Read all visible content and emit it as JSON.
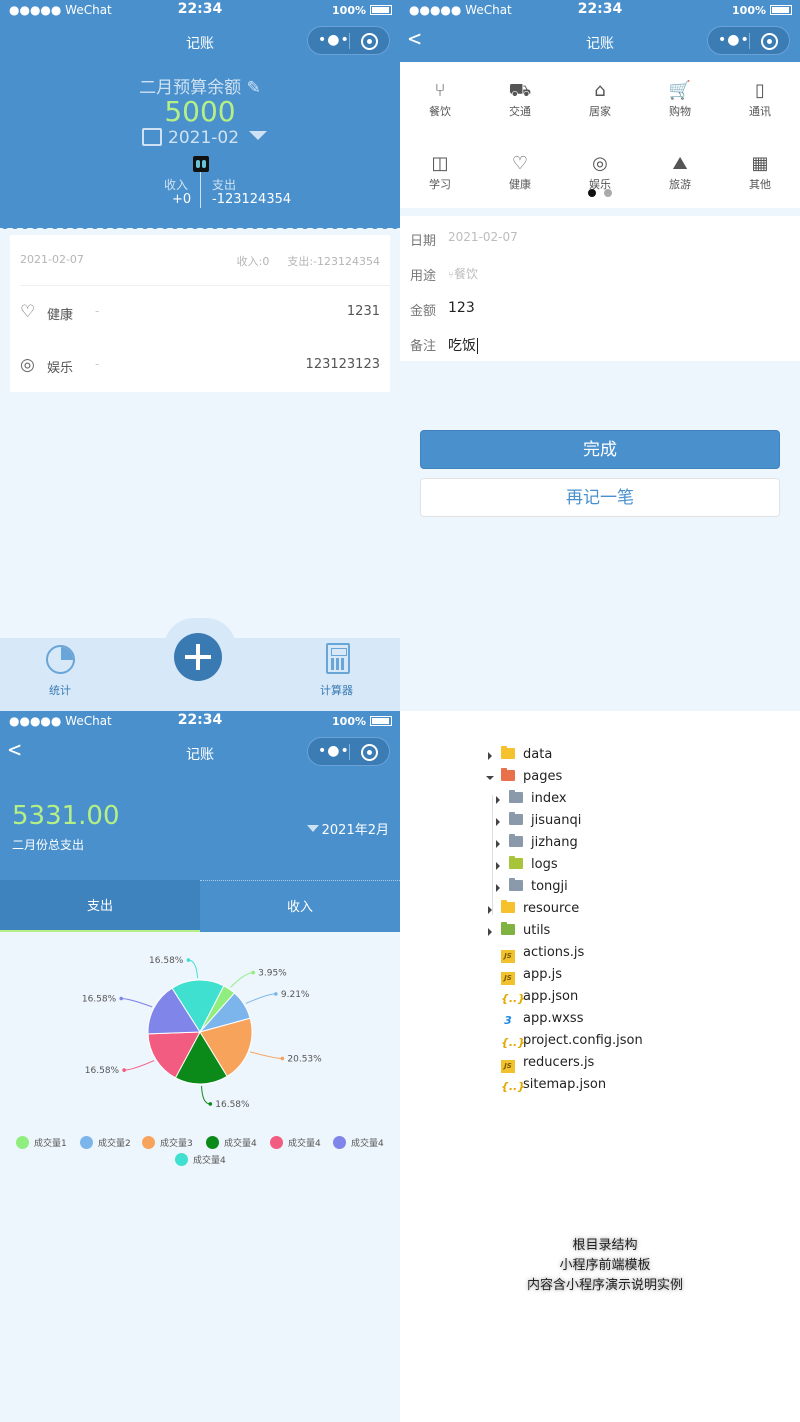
{
  "status_bar": {
    "carrier": "●●●●● WeChat",
    "time": "22:34",
    "battery": "100%"
  },
  "nav": {
    "title": "记账",
    "capsule_dots": "•●•"
  },
  "home": {
    "budget_label": "二月预算余额",
    "budget_value": "5000",
    "month": "2021-02",
    "income_label": "收入",
    "income_value": "+0",
    "expense_label": "支出",
    "expense_value": "-123124354",
    "day_card": {
      "date": "2021-02-07",
      "income": "收入:0",
      "expense": "支出:-123124354",
      "records": [
        {
          "category": "健康",
          "dash": "-",
          "amount": "1231",
          "icon": "heart-pulse-icon"
        },
        {
          "category": "娱乐",
          "dash": "-",
          "amount": "123123123",
          "icon": "entertainment-icon"
        }
      ]
    },
    "tabbar": {
      "stats_label": "统计",
      "calculator_label": "计算器"
    }
  },
  "add": {
    "categories": [
      {
        "label": "餐饮",
        "icon": "fork-knife-icon",
        "glyph": "⑂"
      },
      {
        "label": "交通",
        "icon": "bus-icon",
        "glyph": "⛟"
      },
      {
        "label": "居家",
        "icon": "house-icon",
        "glyph": "⌂"
      },
      {
        "label": "购物",
        "icon": "cart-icon",
        "glyph": "🛒"
      },
      {
        "label": "通讯",
        "icon": "phone-icon",
        "glyph": "▯"
      },
      {
        "label": "学习",
        "icon": "book-icon",
        "glyph": "◫"
      },
      {
        "label": "健康",
        "icon": "heart-pulse-icon",
        "glyph": "♡"
      },
      {
        "label": "娱乐",
        "icon": "entertainment-icon",
        "glyph": "◎"
      },
      {
        "label": "旅游",
        "icon": "mountain-icon",
        "glyph": "⛰"
      },
      {
        "label": "其他",
        "icon": "grid-icon",
        "glyph": "▦"
      }
    ],
    "page_indicator": {
      "active": 1,
      "total": 2
    },
    "form": {
      "date_label": "日期",
      "date_value": "2021-02-07",
      "use_label": "用途",
      "use_value": "餐饮",
      "amount_label": "金额",
      "amount_value": "123",
      "note_label": "备注",
      "note_value": "吃饭"
    },
    "done_button": "完成",
    "again_button": "再记一笔"
  },
  "stats": {
    "total_value": "5331.00",
    "total_label": "二月份总支出",
    "month": "2021年2月",
    "tab_expense": "支出",
    "tab_income": "收入"
  },
  "chart_data": {
    "type": "pie",
    "slices": [
      {
        "name": "成交量1",
        "value": 3.95,
        "label": "3.95%",
        "color": "#90ee7e"
      },
      {
        "name": "成交量2",
        "value": 9.21,
        "label": "9.21%",
        "color": "#7cb5ec"
      },
      {
        "name": "成交量3",
        "value": 20.53,
        "label": "20.53%",
        "color": "#f7a35c"
      },
      {
        "name": "成交量4",
        "value": 16.58,
        "label": "16.58%",
        "color": "#0b8a1a"
      },
      {
        "name": "成交量4",
        "value": 16.58,
        "label": "16.58%",
        "color": "#f15c80"
      },
      {
        "name": "成交量4",
        "value": 16.58,
        "label": "16.58%",
        "color": "#8085e9"
      },
      {
        "name": "成交量4",
        "value": 16.58,
        "label": "16.58%",
        "color": "#40e0d0"
      }
    ]
  },
  "tree": {
    "items": [
      {
        "name": "data",
        "type": "folder",
        "color": "#f5c22e",
        "level": 0,
        "arrow": "closed"
      },
      {
        "name": "pages",
        "type": "folder",
        "color": "#e8704a",
        "level": 0,
        "arrow": "open"
      },
      {
        "name": "index",
        "type": "folder",
        "color": "#8a9aab",
        "level": 1,
        "arrow": "closed"
      },
      {
        "name": "jisuanqi",
        "type": "folder",
        "color": "#8a9aab",
        "level": 1,
        "arrow": "closed"
      },
      {
        "name": "jizhang",
        "type": "folder",
        "color": "#8a9aab",
        "level": 1,
        "arrow": "closed"
      },
      {
        "name": "logs",
        "type": "folder",
        "color": "#a7c43a",
        "level": 1,
        "arrow": "closed"
      },
      {
        "name": "tongji",
        "type": "folder",
        "color": "#8a9aab",
        "level": 1,
        "arrow": "closed"
      },
      {
        "name": "resource",
        "type": "folder",
        "color": "#f5c22e",
        "level": 0,
        "arrow": "closed"
      },
      {
        "name": "utils",
        "type": "folder",
        "color": "#7fb241",
        "level": 0,
        "arrow": "closed"
      },
      {
        "name": "actions.js",
        "type": "js",
        "level": 0
      },
      {
        "name": "app.js",
        "type": "js",
        "level": 0
      },
      {
        "name": "app.json",
        "type": "json",
        "level": 0
      },
      {
        "name": "app.wxss",
        "type": "css",
        "level": 0
      },
      {
        "name": "project.config.json",
        "type": "json",
        "level": 0
      },
      {
        "name": "reducers.js",
        "type": "js",
        "level": 0
      },
      {
        "name": "sitemap.json",
        "type": "json",
        "level": 0
      }
    ],
    "watermark": [
      "根目录结构",
      "小程序前端模板",
      "内容含小程序演示说明实例"
    ]
  }
}
